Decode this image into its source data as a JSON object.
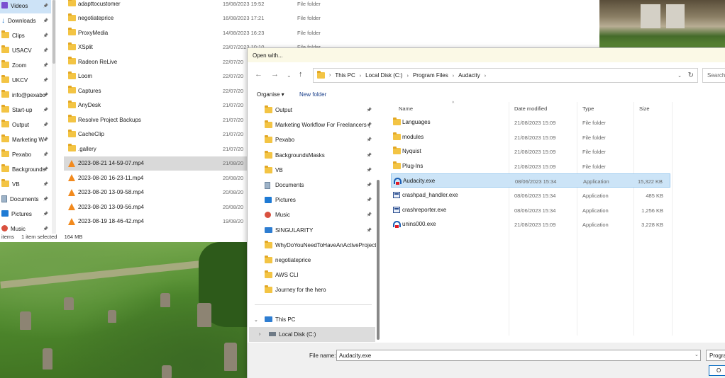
{
  "background_window": {
    "sidebar": [
      {
        "label": "Videos",
        "icon": "videos-icon",
        "selected": true
      },
      {
        "label": "Downloads",
        "icon": "download-icon"
      },
      {
        "label": "Clips",
        "icon": "folder-icon"
      },
      {
        "label": "USACV",
        "icon": "folder-icon"
      },
      {
        "label": "Zoom",
        "icon": "folder-icon"
      },
      {
        "label": "UKCV",
        "icon": "folder-icon"
      },
      {
        "label": "info@pexabo",
        "icon": "folder-icon"
      },
      {
        "label": "Start-up",
        "icon": "folder-icon"
      },
      {
        "label": "Output",
        "icon": "folder-icon"
      },
      {
        "label": "Marketing W",
        "icon": "folder-icon"
      },
      {
        "label": "Pexabo",
        "icon": "folder-icon"
      },
      {
        "label": "Backgrounds",
        "icon": "folder-icon"
      },
      {
        "label": "VB",
        "icon": "folder-icon"
      },
      {
        "label": "Documents",
        "icon": "documents-icon"
      },
      {
        "label": "Pictures",
        "icon": "pictures-icon"
      },
      {
        "label": "Music",
        "icon": "music-icon"
      }
    ],
    "files": [
      {
        "name": "adapttocustomer",
        "date": "19/08/2023 19:52",
        "type": "File folder",
        "icon": "folder-icon"
      },
      {
        "name": "negotiateprice",
        "date": "16/08/2023 17:21",
        "type": "File folder",
        "icon": "folder-icon"
      },
      {
        "name": "ProxyMedia",
        "date": "14/08/2023 16:23",
        "type": "File folder",
        "icon": "folder-icon"
      },
      {
        "name": "XSplit",
        "date": "23/07/2023 10:10",
        "type": "File folder",
        "icon": "folder-icon"
      },
      {
        "name": "Radeon ReLive",
        "date": "22/07/20",
        "type": "",
        "icon": "folder-icon"
      },
      {
        "name": "Loom",
        "date": "22/07/20",
        "type": "",
        "icon": "folder-icon"
      },
      {
        "name": "Captures",
        "date": "22/07/20",
        "type": "",
        "icon": "folder-icon"
      },
      {
        "name": "AnyDesk",
        "date": "21/07/20",
        "type": "",
        "icon": "folder-icon"
      },
      {
        "name": "Resolve Project Backups",
        "date": "21/07/20",
        "type": "",
        "icon": "folder-icon"
      },
      {
        "name": "CacheClip",
        "date": "21/07/20",
        "type": "",
        "icon": "folder-icon"
      },
      {
        "name": ".gallery",
        "date": "21/07/20",
        "type": "",
        "icon": "folder-icon"
      },
      {
        "name": "2023-08-21 14-59-07.mp4",
        "date": "21/08/20",
        "type": "",
        "icon": "vlc-icon",
        "selected": true
      },
      {
        "name": "2023-08-20 16-23-11.mp4",
        "date": "20/08/20",
        "type": "",
        "icon": "vlc-icon"
      },
      {
        "name": "2023-08-20 13-09-58.mp4",
        "date": "20/08/20",
        "type": "",
        "icon": "vlc-icon"
      },
      {
        "name": "2023-08-20 13-09-56.mp4",
        "date": "20/08/20",
        "type": "",
        "icon": "vlc-icon"
      },
      {
        "name": "2023-08-19 18-46-42.mp4",
        "date": "19/08/20",
        "type": "",
        "icon": "vlc-icon"
      }
    ],
    "status": {
      "items": "items",
      "selected": "1 item selected",
      "size": "164 MB"
    }
  },
  "dialog": {
    "title": "Open with...",
    "breadcrumb": [
      "This PC",
      "Local Disk (C:)",
      "Program Files",
      "Audacity"
    ],
    "search_placeholder": "Search...",
    "organise_label": "Organise ▾",
    "new_folder_label": "New folder",
    "tree": [
      {
        "label": "Output",
        "icon": "folder-icon",
        "pinned": true
      },
      {
        "label": "Marketing Workflow For Freelancers (",
        "icon": "folder-icon",
        "pinned": true
      },
      {
        "label": "Pexabo",
        "icon": "folder-icon",
        "pinned": true
      },
      {
        "label": "BackgroundsMasks",
        "icon": "folder-icon",
        "pinned": true
      },
      {
        "label": "VB",
        "icon": "folder-icon",
        "pinned": true
      },
      {
        "label": "Documents",
        "icon": "documents-icon",
        "pinned": true
      },
      {
        "label": "Pictures",
        "icon": "pictures-icon",
        "pinned": true
      },
      {
        "label": "Music",
        "icon": "music-icon",
        "pinned": true
      },
      {
        "label": "SINGULARITY",
        "icon": "monitor-icon",
        "pinned": true
      },
      {
        "label": "WhyDoYouNeedToHaveAnActiveProject",
        "icon": "folder-icon"
      },
      {
        "label": "negotiateprice",
        "icon": "folder-icon"
      },
      {
        "label": "AWS CLI",
        "icon": "folder-icon"
      },
      {
        "label": "Journey for the hero",
        "icon": "folder-icon"
      }
    ],
    "tree_this_pc": "This PC",
    "tree_local_disk": "Local Disk (C:)",
    "columns": {
      "name": "Name",
      "date": "Date modified",
      "type": "Type",
      "size": "Size"
    },
    "files": [
      {
        "name": "Languages",
        "date": "21/08/2023 15:09",
        "type": "File folder",
        "size": "",
        "icon": "folder-icon"
      },
      {
        "name": "modules",
        "date": "21/08/2023 15:09",
        "type": "File folder",
        "size": "",
        "icon": "folder-icon"
      },
      {
        "name": "Nyquist",
        "date": "21/08/2023 15:09",
        "type": "File folder",
        "size": "",
        "icon": "folder-icon"
      },
      {
        "name": "Plug-Ins",
        "date": "21/08/2023 15:09",
        "type": "File folder",
        "size": "",
        "icon": "folder-icon"
      },
      {
        "name": "Audacity.exe",
        "date": "08/06/2023 15:34",
        "type": "Application",
        "size": "15,322 KB",
        "icon": "audacity-icon",
        "selected": true
      },
      {
        "name": "crashpad_handler.exe",
        "date": "08/06/2023 15:34",
        "type": "Application",
        "size": "485 KB",
        "icon": "app-icon"
      },
      {
        "name": "crashreporter.exe",
        "date": "08/06/2023 15:34",
        "type": "Application",
        "size": "1,256 KB",
        "icon": "app-icon"
      },
      {
        "name": "unins000.exe",
        "date": "21/08/2023 15:09",
        "type": "Application",
        "size": "3,228 KB",
        "icon": "audacity-icon"
      }
    ],
    "file_name_label": "File name:",
    "file_name_value": "Audacity.exe",
    "file_type_value": "Progra",
    "open_button": "O"
  }
}
